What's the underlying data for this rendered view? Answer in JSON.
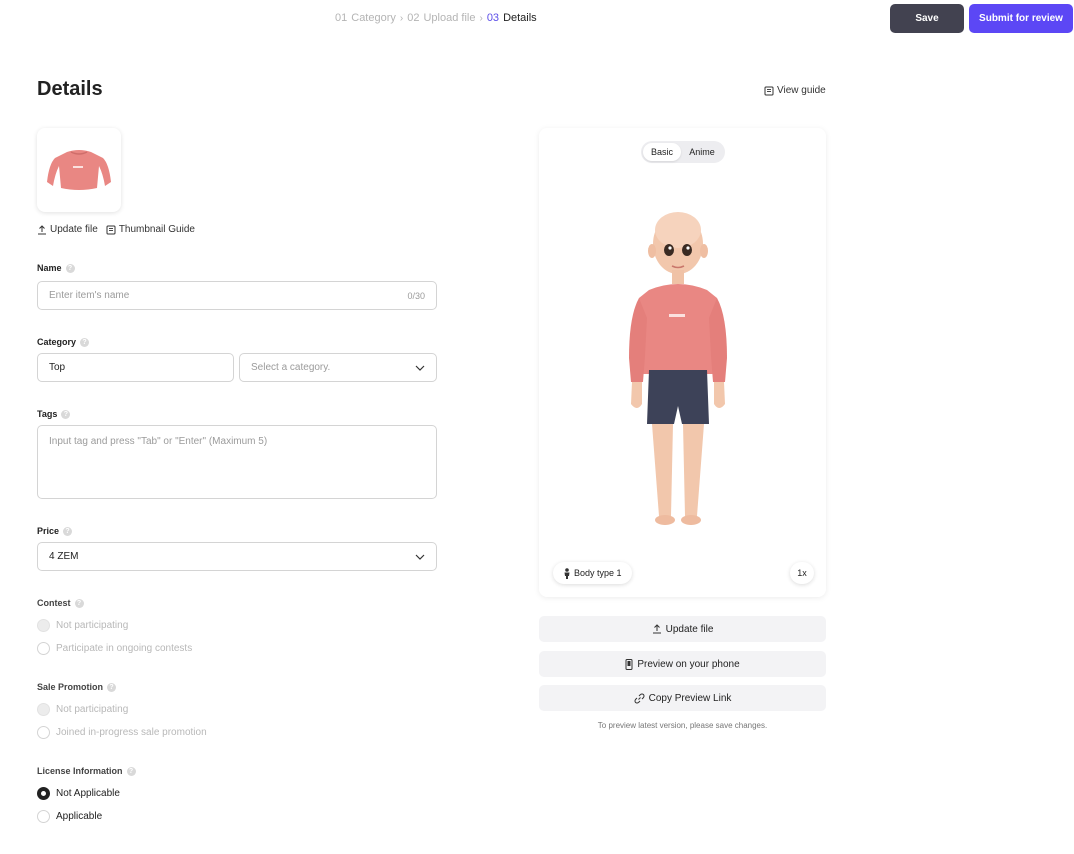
{
  "header": {
    "steps": [
      {
        "num": "01",
        "label": "Category"
      },
      {
        "num": "02",
        "label": "Upload file"
      },
      {
        "num": "03",
        "label": "Details"
      }
    ],
    "save_label": "Save",
    "submit_label": "Submit for review"
  },
  "page": {
    "title": "Details",
    "view_guide": "View guide"
  },
  "thumbnail": {
    "update_file": "Update file",
    "guide": "Thumbnail Guide"
  },
  "form": {
    "name": {
      "label": "Name",
      "placeholder": "Enter item's name",
      "counter": "0/30",
      "value": ""
    },
    "category": {
      "label": "Category",
      "value": "Top",
      "sub_placeholder": "Select a category."
    },
    "tags": {
      "label": "Tags",
      "placeholder": "Input tag and press \"Tab\" or \"Enter\" (Maximum 5)"
    },
    "price": {
      "label": "Price",
      "value": "4 ZEM"
    },
    "contest": {
      "label": "Contest",
      "options": [
        "Not participating",
        "Participate in ongoing contests"
      ]
    },
    "sale": {
      "label": "Sale Promotion",
      "options": [
        "Not participating",
        "Joined in-progress sale promotion"
      ]
    },
    "license": {
      "label": "License Information",
      "options": [
        "Not Applicable",
        "Applicable"
      ],
      "selected": "Not Applicable"
    }
  },
  "preview": {
    "tabs": [
      "Basic",
      "Anime"
    ],
    "active_tab": "Basic",
    "body_type": "Body type 1",
    "zoom": "1x",
    "update_file": "Update file",
    "preview_phone": "Preview on your phone",
    "copy_link": "Copy Preview Link",
    "note": "To preview latest version, please save changes."
  },
  "colors": {
    "accent": "#5c47f5",
    "save": "#424250",
    "shirt": "#e98783",
    "shorts": "#3d4258"
  }
}
